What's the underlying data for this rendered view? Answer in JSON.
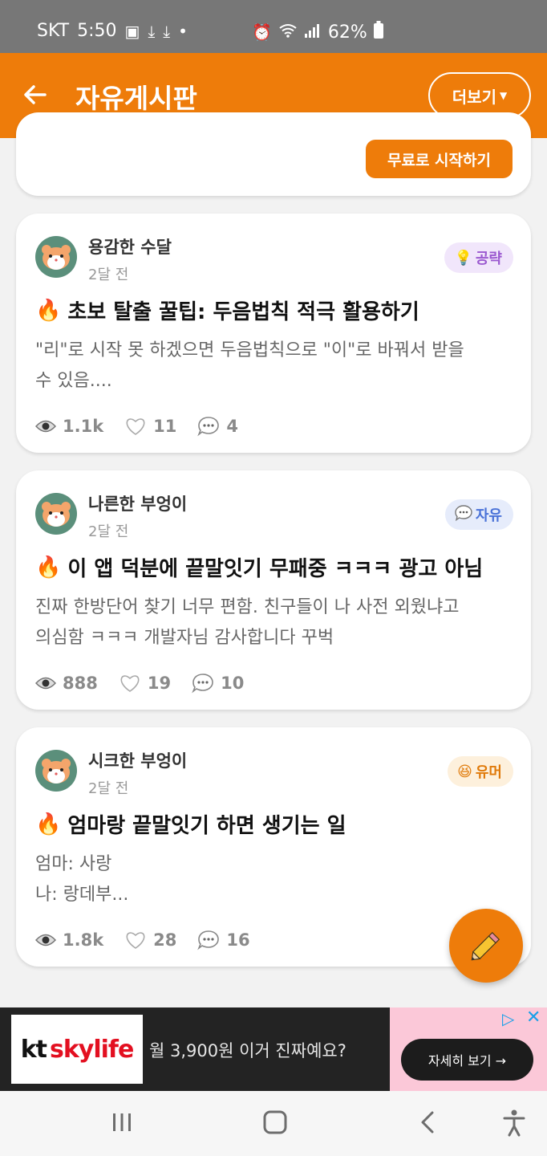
{
  "status_bar": {
    "carrier": "SKT",
    "time": "5:50",
    "battery": "62%"
  },
  "header": {
    "title": "자유게시판",
    "more_label": "더보기"
  },
  "banner": {
    "start_label": "무료로 시작하기"
  },
  "posts": [
    {
      "author": "용감한 수달",
      "time": "2달 전",
      "tag": "공략",
      "tag_icon": "lightbulb-icon",
      "tag_color": "#9b59d0",
      "tag_bg": "#f1e6fb",
      "title": "초보 탈출 꿀팁: 두음법칙 적극 활용하기",
      "body_lines": [
        "\"리\"로 시작 못 하겠으면 두음법칙으로 \"이\"로 바꿔서 받을",
        "수 있음...."
      ],
      "views": "1.1k",
      "likes": "11",
      "comments": "4"
    },
    {
      "author": "나른한 부엉이",
      "time": "2달 전",
      "tag": "자유",
      "tag_icon": "speech-bubble-icon",
      "tag_color": "#4a72d8",
      "tag_bg": "#e6ecfb",
      "title": "이 앱 덕분에 끝말잇기 무패중 ㅋㅋㅋ 광고 아님",
      "body_lines": [
        "진짜 한방단어 찾기 너무 편함. 친구들이 나 사전 외웠냐고",
        "의심함 ㅋㅋㅋ 개발자님 감사합니다 꾸벅"
      ],
      "views": "888",
      "likes": "19",
      "comments": "10"
    },
    {
      "author": "시크한 부엉이",
      "time": "2달 전",
      "tag": "유머",
      "tag_icon": "laughing-face-icon",
      "tag_color": "#e07a0a",
      "tag_bg": "#fdf0dc",
      "title": "엄마랑 끝말잇기 하면 생기는 일",
      "body_lines": [
        "엄마: 사랑",
        "나: 랑데부..."
      ],
      "views": "1.8k",
      "likes": "28",
      "comments": "16"
    }
  ],
  "ad": {
    "brand_kt": "kt",
    "brand_name": "skylife",
    "text": "월 3,900원 이거 진짜예요?",
    "cta": "자세히 보기 →"
  },
  "colors": {
    "accent": "#ee7c0a",
    "status_bar": "#777777"
  }
}
